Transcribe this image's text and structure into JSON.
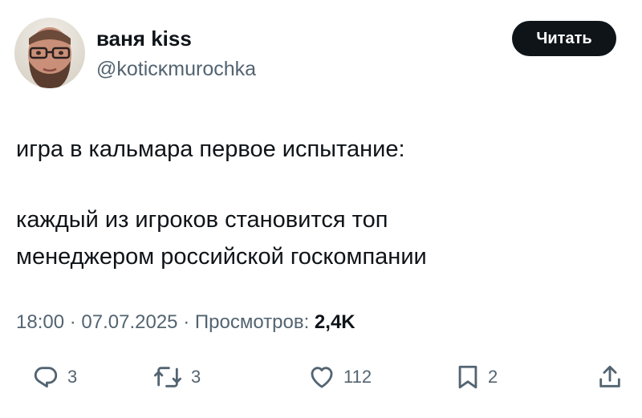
{
  "author": {
    "display_name": "ваня kiss",
    "handle": "@koticĸmurochka",
    "avatar_icon": "avatar-photo"
  },
  "follow_button": {
    "label": "Читать"
  },
  "tweet": {
    "line1": "игра в кальмара первое испытание:",
    "line2": "каждый из игроков становится топ",
    "line3": "менеджером российской госкомпании"
  },
  "meta": {
    "time": "18:00",
    "date": "07.07.2025",
    "views_label": "Просмотров:",
    "views_count": "2,4K",
    "separator": "·"
  },
  "actions": {
    "replies": "3",
    "reposts": "3",
    "likes": "112",
    "bookmarks": "2"
  },
  "colors": {
    "text": "#0f1419",
    "secondary": "#536471",
    "button_bg": "#0f1419",
    "button_text": "#ffffff"
  }
}
